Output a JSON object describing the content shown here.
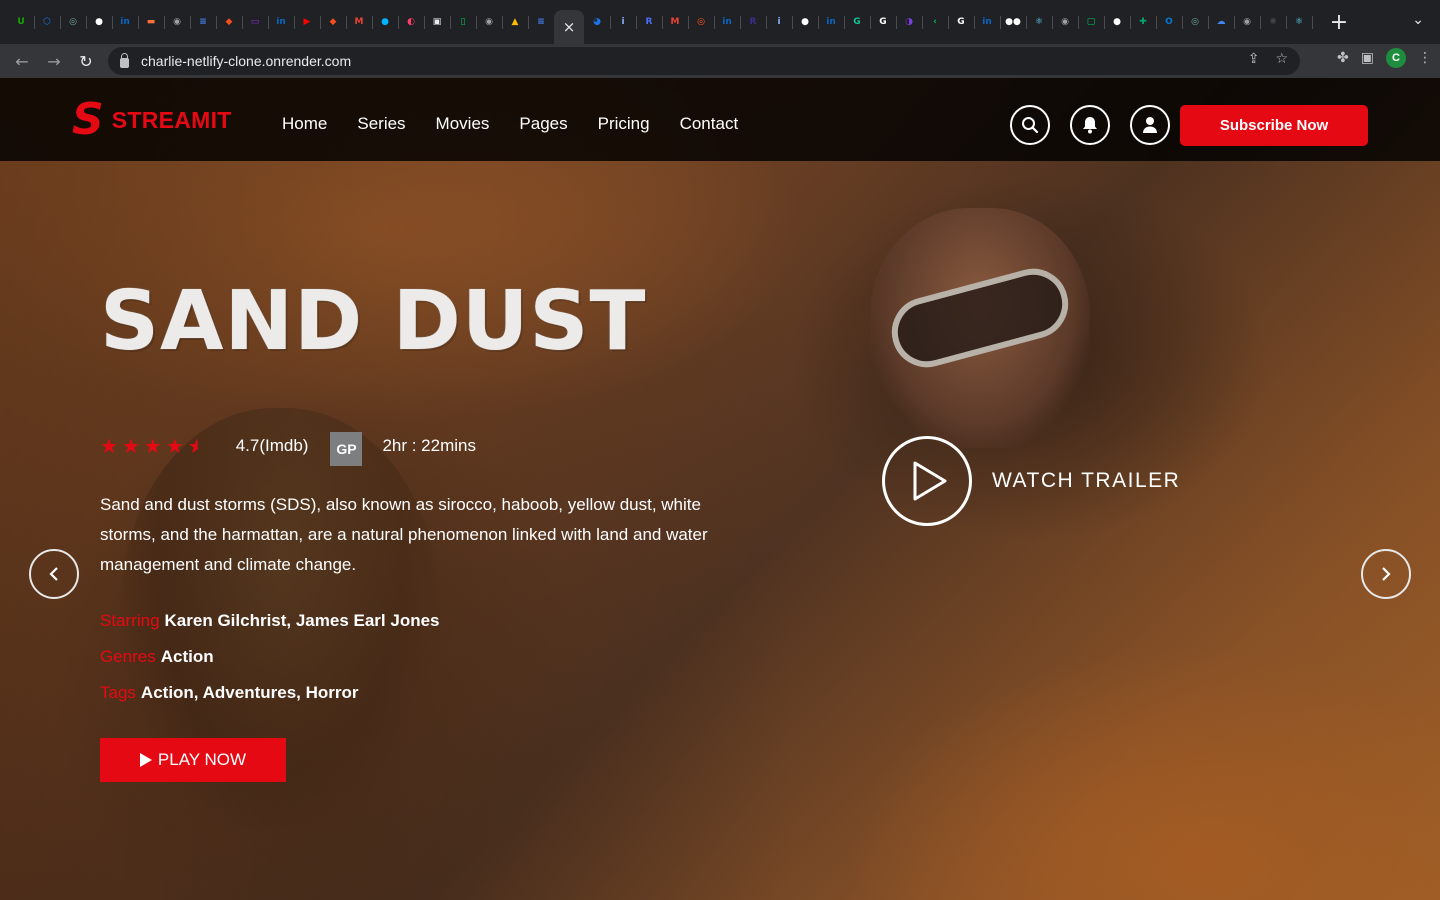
{
  "browser": {
    "tabs": [
      {
        "icon": "upwork-icon",
        "color": "#14a800",
        "glyph": "U"
      },
      {
        "icon": "hexagon-icon",
        "color": "#1a73e8",
        "glyph": "⬡"
      },
      {
        "icon": "chatgpt-icon",
        "color": "#74aa9c",
        "glyph": "◎"
      },
      {
        "icon": "github-icon",
        "color": "#ffffff",
        "glyph": "●"
      },
      {
        "icon": "linkedin-icon",
        "color": "#0a66c2",
        "glyph": "in"
      },
      {
        "icon": "slides-icon",
        "color": "#ff7139",
        "glyph": "▬"
      },
      {
        "icon": "globe-icon",
        "color": "#9aa0a6",
        "glyph": "◉"
      },
      {
        "icon": "docs-icon",
        "color": "#4285f4",
        "glyph": "≡"
      },
      {
        "icon": "figma-icon",
        "color": "#f24e1e",
        "glyph": "◆"
      },
      {
        "icon": "hackerrank-icon",
        "color": "#8a2be2",
        "glyph": "▭"
      },
      {
        "icon": "linkedin-icon",
        "color": "#0a66c2",
        "glyph": "in"
      },
      {
        "icon": "youtube-icon",
        "color": "#ff0000",
        "glyph": "▶"
      },
      {
        "icon": "figma-icon",
        "color": "#f24e1e",
        "glyph": "◆"
      },
      {
        "icon": "gmail-icon",
        "color": "#ea4335",
        "glyph": "M"
      },
      {
        "icon": "bubble-icon",
        "color": "#00b2ff",
        "glyph": "●"
      },
      {
        "icon": "pill-icon",
        "color": "#ff3e6c",
        "glyph": "◐"
      },
      {
        "icon": "camera-icon",
        "color": "#e8eaed",
        "glyph": "▣"
      },
      {
        "icon": "phone-icon",
        "color": "#00c853",
        "glyph": "▯"
      },
      {
        "icon": "globe-icon",
        "color": "#9aa0a6",
        "glyph": "◉"
      },
      {
        "icon": "drive-icon",
        "color": "#fbbc04",
        "glyph": "▲"
      },
      {
        "icon": "docs-icon",
        "color": "#4285f4",
        "glyph": "≡"
      },
      {
        "icon": "close-icon",
        "color": "#e8eaed",
        "glyph": "×",
        "active": true
      },
      {
        "icon": "edge-icon",
        "color": "#1a73e8",
        "glyph": "◕"
      },
      {
        "icon": "info-icon",
        "color": "#8ab4f8",
        "glyph": "i"
      },
      {
        "icon": "r-icon",
        "color": "#4a6cf7",
        "glyph": "R"
      },
      {
        "icon": "gmail-icon",
        "color": "#ea4335",
        "glyph": "M"
      },
      {
        "icon": "target-icon",
        "color": "#ff5722",
        "glyph": "◎"
      },
      {
        "icon": "linkedin-icon",
        "color": "#0a66c2",
        "glyph": "in"
      },
      {
        "icon": "r-icon",
        "color": "#3b2d8f",
        "glyph": "R"
      },
      {
        "icon": "info-icon",
        "color": "#8ab4f8",
        "glyph": "i"
      },
      {
        "icon": "github-icon",
        "color": "#ffffff",
        "glyph": "●"
      },
      {
        "icon": "linkedin-icon",
        "color": "#0a66c2",
        "glyph": "in"
      },
      {
        "icon": "grammarly-icon",
        "color": "#15c39a",
        "glyph": "G"
      },
      {
        "icon": "google-icon",
        "color": "#ffffff",
        "glyph": "G"
      },
      {
        "icon": "ph-icon",
        "color": "#7b3fe4",
        "glyph": "◑"
      },
      {
        "icon": "chevron-left-icon",
        "color": "#00c853",
        "glyph": "‹"
      },
      {
        "icon": "google-icon",
        "color": "#ffffff",
        "glyph": "G"
      },
      {
        "icon": "linkedin-icon",
        "color": "#0a66c2",
        "glyph": "in"
      },
      {
        "icon": "medium-icon",
        "color": "#ffffff",
        "glyph": "●●"
      },
      {
        "icon": "react-icon",
        "color": "#61dafb",
        "glyph": "⚛"
      },
      {
        "icon": "globe-icon",
        "color": "#9aa0a6",
        "glyph": "◉"
      },
      {
        "icon": "square-icon",
        "color": "#00c853",
        "glyph": "▢"
      },
      {
        "icon": "github-icon",
        "color": "#ffffff",
        "glyph": "●"
      },
      {
        "icon": "plus-square-icon",
        "color": "#00a86b",
        "glyph": "✚"
      },
      {
        "icon": "outlook-icon",
        "color": "#0078d4",
        "glyph": "O"
      },
      {
        "icon": "chatgpt-icon",
        "color": "#74aa9c",
        "glyph": "◎"
      },
      {
        "icon": "cloud-icon",
        "color": "#4285f4",
        "glyph": "☁"
      },
      {
        "icon": "globe-icon",
        "color": "#9aa0a6",
        "glyph": "◉"
      },
      {
        "icon": "openai-icon",
        "color": "#444444",
        "glyph": "✺"
      },
      {
        "icon": "react-icon",
        "color": "#61dafb",
        "glyph": "⚛"
      }
    ],
    "new_tab": "+",
    "tab_menu": "⌄",
    "url": "charlie-netlify-clone.onrender.com",
    "profile_initial": "C"
  },
  "site": {
    "brand": "STREAMIT",
    "brand_letter": "S",
    "nav": [
      "Home",
      "Series",
      "Movies",
      "Pages",
      "Pricing",
      "Contact"
    ],
    "subscribe": "Subscribe Now",
    "accent": "#e50914"
  },
  "hero": {
    "title": "SAND DUST",
    "rating_stars": 4.5,
    "rating": "4.7(Imdb)",
    "badge": "GP",
    "duration": "2hr : 22mins",
    "description": "Sand and dust storms (SDS), also known as sirocco, haboob, yellow dust, white storms, and the harmattan, are a natural phenomenon linked with land and water management and climate change.",
    "starring_label": "Starring",
    "starring": "Karen Gilchrist, James Earl Jones",
    "genres_label": "Genres",
    "genres": "Action",
    "tags_label": "Tags",
    "tags": "Action, Adventures, Horror",
    "play": "PLAY NOW",
    "trailer": "WATCH TRAILER"
  }
}
